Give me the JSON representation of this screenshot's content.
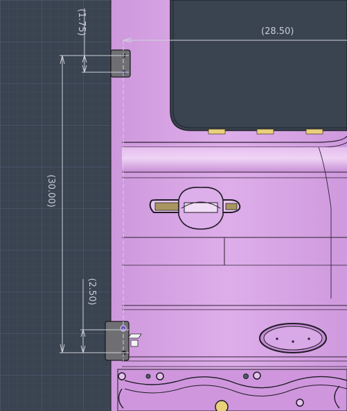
{
  "app": {
    "type": "CAD drawing viewport",
    "background_color": "#3a4350",
    "grid_color": "#4d5868",
    "part_color": "#d9a6e6"
  },
  "dimensions": {
    "top_horizontal": "(28.50)",
    "top_vertical": "(1.75)",
    "main_vertical": "(30.00)",
    "bottom_vertical": "(2.50)"
  },
  "icons": {
    "clip_marker": "clip-marker-icon",
    "constraint": "constraint-icon"
  }
}
